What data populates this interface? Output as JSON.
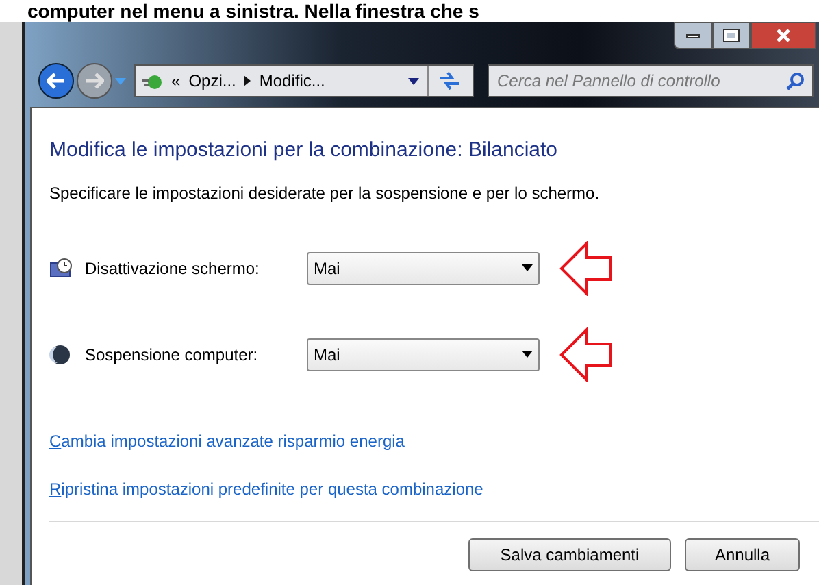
{
  "caption": "computer nel menu a sinistra. Nella finestra che s",
  "address_bar": {
    "breadcrumbs": [
      "«",
      "Opzi...",
      "Modific..."
    ]
  },
  "search": {
    "placeholder": "Cerca nel Pannello di controllo"
  },
  "page": {
    "title": "Modifica le impostazioni per la combinazione: Bilanciato",
    "subtitle": "Specificare le impostazioni desiderate per la sospensione e per lo schermo."
  },
  "settings": [
    {
      "kind": "display",
      "label": "Disattivazione schermo:",
      "value": "Mai"
    },
    {
      "kind": "sleep",
      "label": "Sospensione computer:",
      "value": "Mai"
    }
  ],
  "links": [
    "Cambia impostazioni avanzate risparmio energia",
    "Ripristina impostazioni predefinite per questa combinazione"
  ],
  "buttons": [
    "Salva cambiamenti",
    "Annulla"
  ]
}
